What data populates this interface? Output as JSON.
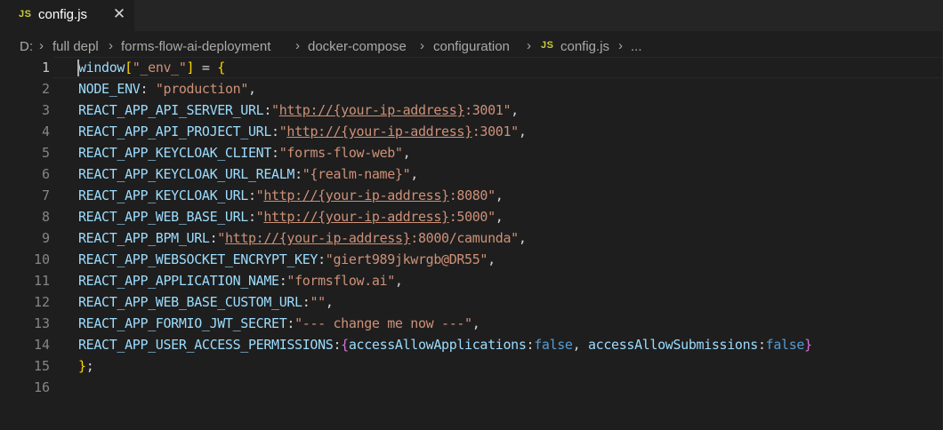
{
  "tab": {
    "icon": "JS",
    "label": "config.js",
    "close_glyph": "✕"
  },
  "breadcrumb": {
    "items": [
      "D:",
      "full depl",
      "forms-flow-ai-deployment",
      "docker-compose",
      "configuration",
      "config.js",
      "..."
    ],
    "file_icon": "JS",
    "separator": "›"
  },
  "editor": {
    "line_numbers": [
      "1",
      "2",
      "3",
      "4",
      "5",
      "6",
      "7",
      "8",
      "9",
      "10",
      "11",
      "12",
      "13",
      "14",
      "15",
      "16"
    ],
    "lines": [
      {
        "key": "window",
        "b1": "[",
        "str": "\"_env_\"",
        "b2": "]",
        "rest": " = ",
        "brace": "{"
      },
      {
        "key": "NODE_ENV",
        "sep": ": ",
        "val": "\"production\"",
        "end": ","
      },
      {
        "key": "REACT_APP_API_SERVER_URL",
        "sep": ":",
        "q1": "\"",
        "url": "http://{your-ip-address}",
        "tail": ":3001\"",
        "end": ","
      },
      {
        "key": "REACT_APP_API_PROJECT_URL",
        "sep": ":",
        "q1": "\"",
        "url": "http://{your-ip-address}",
        "tail": ":3001\"",
        "end": ","
      },
      {
        "key": "REACT_APP_KEYCLOAK_CLIENT",
        "sep": ":",
        "val": "\"forms-flow-web\"",
        "end": ","
      },
      {
        "key": "REACT_APP_KEYCLOAK_URL_REALM",
        "sep": ":",
        "val": "\"{realm-name}\"",
        "end": ","
      },
      {
        "key": "REACT_APP_KEYCLOAK_URL",
        "sep": ":",
        "q1": "\"",
        "url": "http://{your-ip-address}",
        "tail": ":8080\"",
        "end": ","
      },
      {
        "key": "REACT_APP_WEB_BASE_URL",
        "sep": ":",
        "q1": "\"",
        "url": "http://{your-ip-address}",
        "tail": ":5000\"",
        "end": ","
      },
      {
        "key": "REACT_APP_BPM_URL",
        "sep": ":",
        "q1": "\"",
        "url": "http://{your-ip-address}",
        "tail": ":8000/camunda\"",
        "end": ","
      },
      {
        "key": "REACT_APP_WEBSOCKET_ENCRYPT_KEY",
        "sep": ":",
        "val": "\"giert989jkwrgb@DR55\"",
        "end": ","
      },
      {
        "key": "REACT_APP_APPLICATION_NAME",
        "sep": ":",
        "val": "\"formsflow.ai\"",
        "end": ","
      },
      {
        "key": "REACT_APP_WEB_BASE_CUSTOM_URL",
        "sep": ":",
        "val": "\"\"",
        "end": ","
      },
      {
        "key": "REACT_APP_FORMIO_JWT_SECRET",
        "sep": ":",
        "val": "\"--- change me now ---\"",
        "end": ","
      },
      {
        "key": "REACT_APP_USER_ACCESS_PERMISSIONS",
        "sep": ":",
        "ob": "{",
        "k1": "accessAllowApplications",
        "c1": ":",
        "v1": "false",
        "comma": ", ",
        "k2": "accessAllowSubmissions",
        "c2": ":",
        "v2": "false",
        "cb": "}"
      },
      {
        "brace": "}",
        "end": ";"
      },
      {}
    ]
  },
  "colors": {
    "background": "#1e1e1e",
    "tabbar": "#252526",
    "property": "#9cdcfe",
    "string": "#ce9178",
    "keyword": "#569cd6",
    "bracket1": "#ffd700",
    "bracket2": "#da70d6",
    "js_icon": "#cbcb41"
  }
}
